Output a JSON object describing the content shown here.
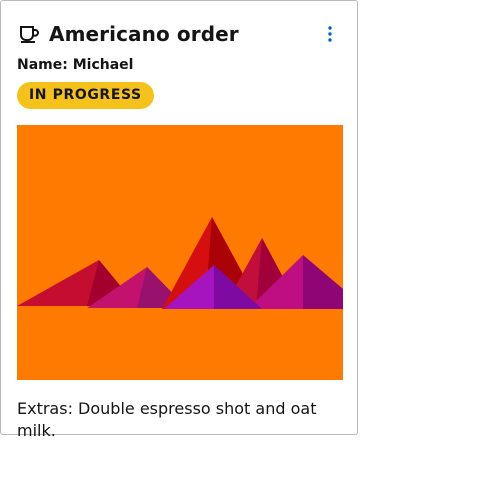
{
  "card": {
    "title": "Americano order",
    "name_line": "Name: Michael",
    "status": "IN PROGRESS",
    "extras": "Extras: Double espresso shot and oat milk.",
    "image_alt": "Mountains illustration"
  },
  "icons": {
    "title_icon": "coffee-cup-icon",
    "menu_icon": "kebab-menu-icon"
  },
  "colors": {
    "status_badge": "#f4c21b",
    "image_background": "#ff7a00",
    "menu_accent": "#0066cc"
  }
}
